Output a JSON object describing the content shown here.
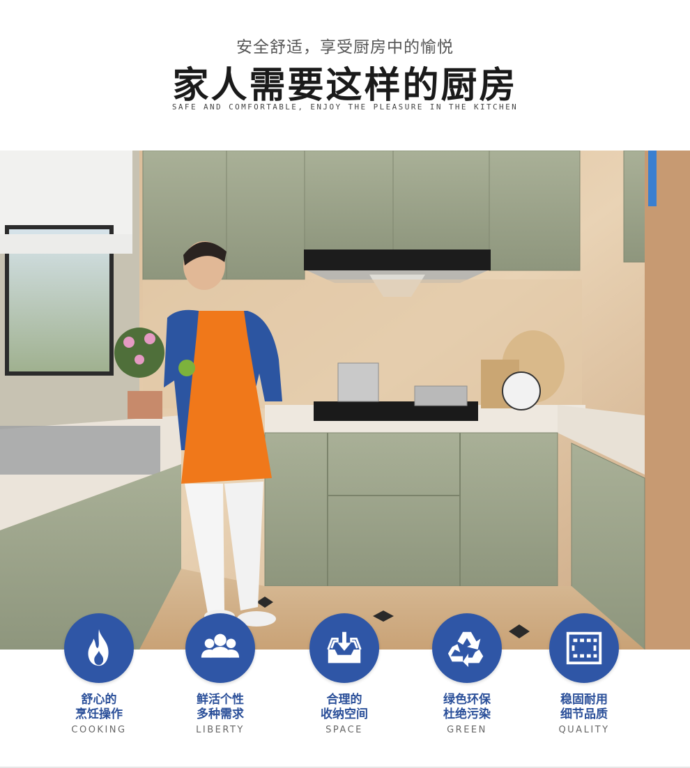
{
  "header": {
    "subtitle": "安全舒适，享受厨房中的愉悦",
    "title": "家人需要这样的厨房",
    "english": "SAFE AND COMFORTABLE, ENJOY THE PLEASURE IN THE KITCHEN"
  },
  "photo": {
    "name": "kitchen-photo"
  },
  "colors": {
    "accent": "#2f56a6",
    "label": "#2a4f99"
  },
  "features": [
    {
      "icon": "flame-icon",
      "line1": "舒心的",
      "line2": "烹饪操作",
      "en": "COOKING"
    },
    {
      "icon": "people-icon",
      "line1": "鲜活个性",
      "line2": "多种需求",
      "en": "LIBERTY"
    },
    {
      "icon": "storage-tray-icon",
      "line1": "合理的",
      "line2": "收纳空间",
      "en": "SPACE"
    },
    {
      "icon": "recycle-icon",
      "line1": "绿色环保",
      "line2": "杜绝污染",
      "en": "GREEN"
    },
    {
      "icon": "film-strip-icon",
      "line1": "稳固耐用",
      "line2": "细节品质",
      "en": "QUALITY"
    }
  ]
}
